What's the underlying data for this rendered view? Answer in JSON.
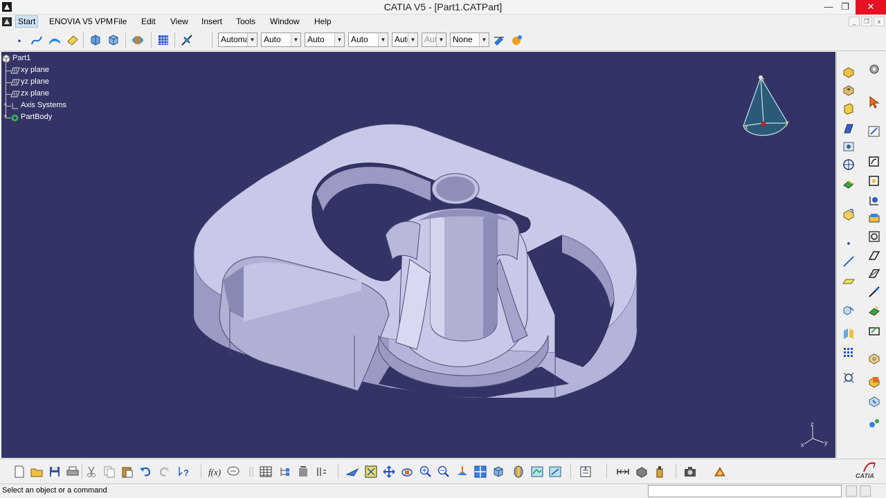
{
  "window": {
    "title": "CATIA V5 - [Part1.CATPart]",
    "minimize": "—",
    "restore": "❐",
    "close": "✕"
  },
  "menu": {
    "items": [
      "Start",
      "ENOVIA V5 VPM",
      "File",
      "Edit",
      "View",
      "Insert",
      "Tools",
      "Window",
      "Help"
    ]
  },
  "toolbar": {
    "combos": [
      {
        "value": "Automatic",
        "enabled": true
      },
      {
        "value": "Auto",
        "enabled": true
      },
      {
        "value": "Auto",
        "enabled": true
      },
      {
        "value": "Auto",
        "enabled": true
      },
      {
        "value": "Auto",
        "enabled": true
      },
      {
        "value": "Auto",
        "enabled": false
      },
      {
        "value": "None",
        "enabled": true
      }
    ]
  },
  "tree": {
    "root": "Part1",
    "items": [
      "xy plane",
      "yz plane",
      "zx plane",
      "Axis Systems",
      "PartBody"
    ]
  },
  "compass": {
    "z": "z",
    "x": "x",
    "y": "y"
  },
  "axis_triad": {
    "z": "z",
    "x": "x",
    "y": "y"
  },
  "status": {
    "message": "Select an object or a command",
    "command_input": ""
  },
  "logo": {
    "text": "CATIA"
  },
  "colors": {
    "viewport_bg": "#333366",
    "part_face": "#c8c8e8",
    "part_dark": "#8a8ab0"
  },
  "icons": {
    "left_toolbar": [
      "point-icon",
      "spline-icon",
      "surface-icon",
      "eraser-icon",
      "view-icon",
      "view-icon",
      "render-icon",
      "grid-icon",
      "measure-icon"
    ],
    "right_toolbar": [
      "box-icon",
      "gear-icon",
      "pointer-icon",
      "sketch-icon"
    ]
  }
}
